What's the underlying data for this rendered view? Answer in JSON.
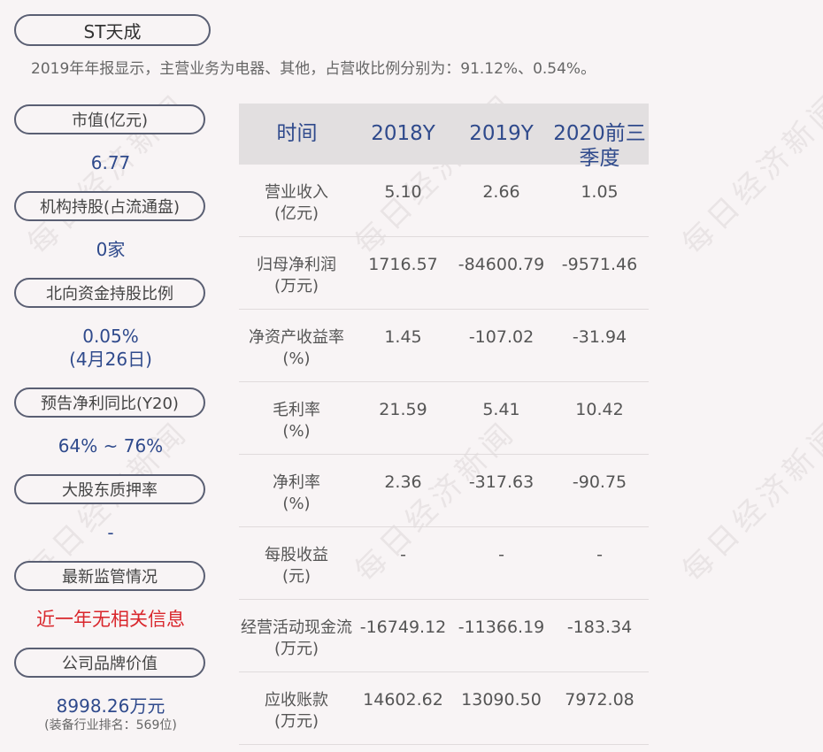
{
  "title": "ST天成",
  "summary": "2019年年报显示，主营业务为电器、其他，占营收比例分别为：91.12%、0.54%。",
  "watermark": "每日经济新闻",
  "left": [
    {
      "label": "市值(亿元)",
      "value": "6.77"
    },
    {
      "label": "机构持股(占流通盘)",
      "value": "0家"
    },
    {
      "label": "北向资金持股比例",
      "value": "0.05%",
      "value2": "(4月26日)"
    },
    {
      "label": "预告净利同比(Y20)",
      "value": "64% ~ 76%"
    },
    {
      "label": "大股东质押率",
      "value": "-"
    },
    {
      "label": "最新监管情况",
      "value": "近一年无相关信息"
    },
    {
      "label": "公司品牌价值",
      "value": "8998.26万元",
      "note": "(装备行业排名：569位)"
    }
  ],
  "table": {
    "headers": [
      "时间",
      "2018Y",
      "2019Y",
      "2020前三",
      "季度"
    ],
    "rows": [
      {
        "label1": "营业收入",
        "label2": "(亿元)",
        "values": [
          "5.10",
          "2.66",
          "1.05"
        ]
      },
      {
        "label1": "归母净利润",
        "label2": "(万元)",
        "values": [
          "1716.57",
          "-84600.79",
          "-9571.46"
        ]
      },
      {
        "label1": "净资产收益率",
        "label2": "(%)",
        "values": [
          "1.45",
          "-107.02",
          "-31.94"
        ]
      },
      {
        "label1": "毛利率",
        "label2": "(%)",
        "values": [
          "21.59",
          "5.41",
          "10.42"
        ]
      },
      {
        "label1": "净利率",
        "label2": "(%)",
        "values": [
          "2.36",
          "-317.63",
          "-90.75"
        ]
      },
      {
        "label1": "每股收益",
        "label2": "(元)",
        "values": [
          "-",
          "-",
          "-"
        ]
      },
      {
        "label1": "经营活动现金流",
        "label2": "(万元)",
        "values": [
          "-16749.12",
          "-11366.19",
          "-183.34"
        ]
      },
      {
        "label1": "应收账款",
        "label2": "(万元)",
        "values": [
          "14602.62",
          "13090.50",
          "7972.08"
        ]
      }
    ]
  },
  "colors": {
    "accent": "#2f4a8c",
    "alert": "#d9262c",
    "background": "#f8f4f5"
  }
}
